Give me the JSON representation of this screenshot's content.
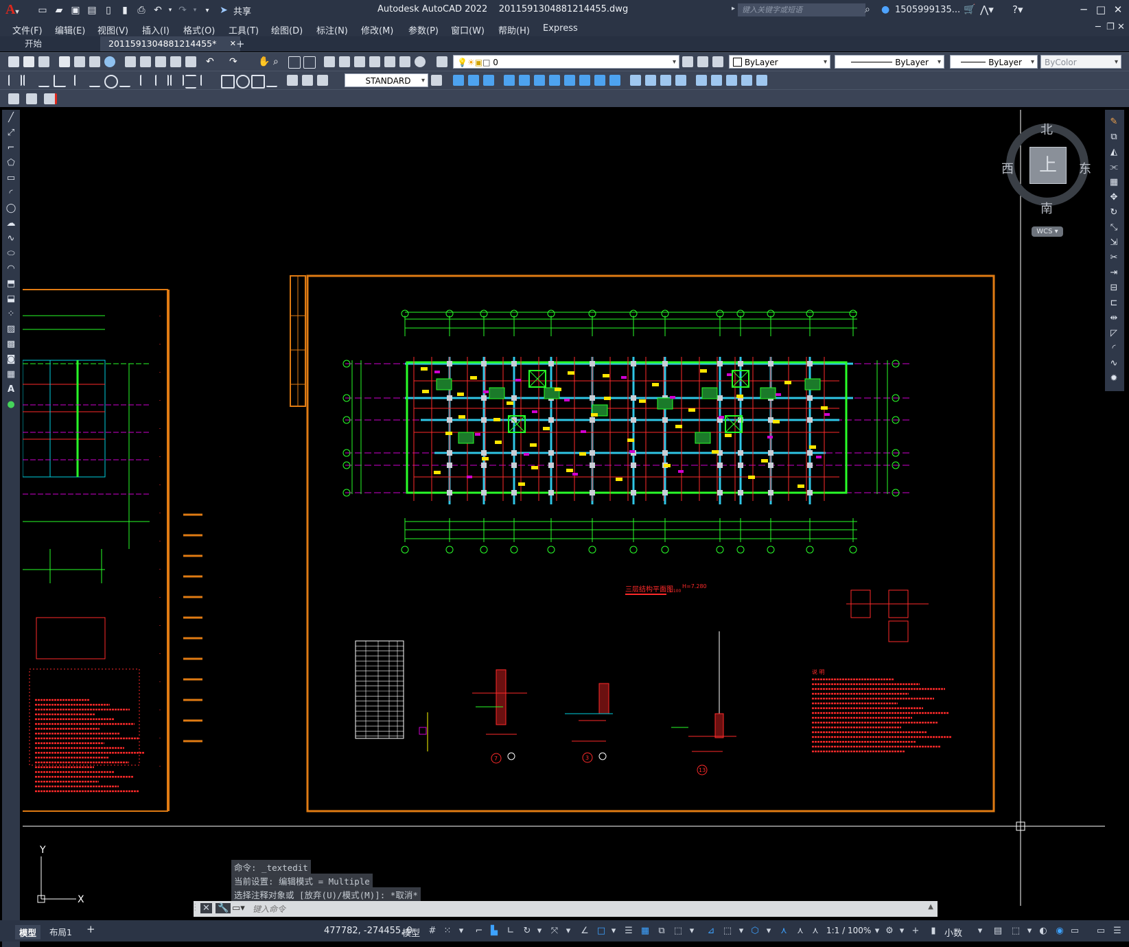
{
  "title_bar": {
    "app_title": "Autodesk AutoCAD 2022    2011591304881214455.dwg",
    "share_label": "共享",
    "search_placeholder": "键入关键字或短语",
    "user_label": "1505999135..."
  },
  "menu": [
    "文件(F)",
    "编辑(E)",
    "视图(V)",
    "插入(I)",
    "格式(O)",
    "工具(T)",
    "绘图(D)",
    "标注(N)",
    "修改(M)",
    "参数(P)",
    "窗口(W)",
    "帮助(H)",
    "Express"
  ],
  "tabs": {
    "start": "开始",
    "file": "2011591304881214455*",
    "add": "+"
  },
  "toolbar": {
    "layer_value": "0",
    "color_value": "ByLayer",
    "linetype_value": "ByLayer",
    "lineweight_value": "ByLayer",
    "plotstyle_value": "ByColor",
    "dimstyle_value": "STANDARD"
  },
  "viewcube": {
    "north": "北",
    "south": "南",
    "east": "东",
    "west": "西",
    "top": "上",
    "wcs": "WCS"
  },
  "drawing": {
    "plan_title": "三层结构平面图",
    "plan_scale": "1:100",
    "plan_elev": "H=7.280",
    "notes_heading": "说 明",
    "detail_markers": [
      "7",
      "3",
      "13"
    ],
    "ucs_x": "X",
    "ucs_y": "Y"
  },
  "command": {
    "history": [
      "命令: _textedit",
      "当前设置: 编辑模式 = Multiple",
      "选择注释对象或 [放弃(U)/模式(M)]: *取消*"
    ],
    "placeholder": "键入命令"
  },
  "status": {
    "model_tab": "模型",
    "layout_tab": "布局1",
    "add_tab": "+",
    "coords": "477782, -274455, 0",
    "space": "模型",
    "annoscale": "1:1 / 100%",
    "units": "小数"
  }
}
